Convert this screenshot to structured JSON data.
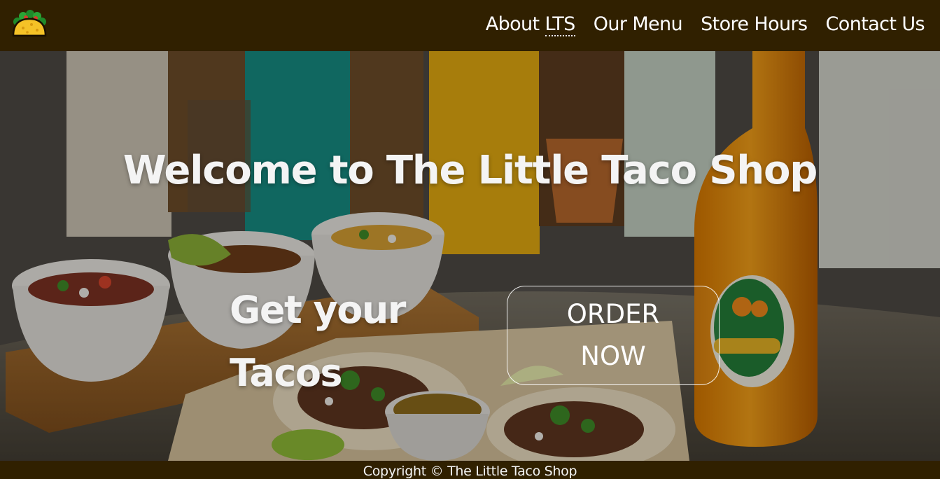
{
  "header": {
    "nav": [
      {
        "prefix": "About ",
        "abbr": "LTS"
      },
      {
        "label": "Our Menu"
      },
      {
        "label": "Store Hours"
      },
      {
        "label": "Contact Us"
      }
    ]
  },
  "hero": {
    "title": "Welcome to The Little Taco Shop",
    "subtitle": "Get your Tacos",
    "order_button": "ORDER NOW"
  },
  "footer": {
    "copyright": "Copyright © The Little Taco Shop"
  },
  "colors": {
    "header_bg": "#302000",
    "footer_bg": "#302000",
    "text": "#ffffff"
  }
}
